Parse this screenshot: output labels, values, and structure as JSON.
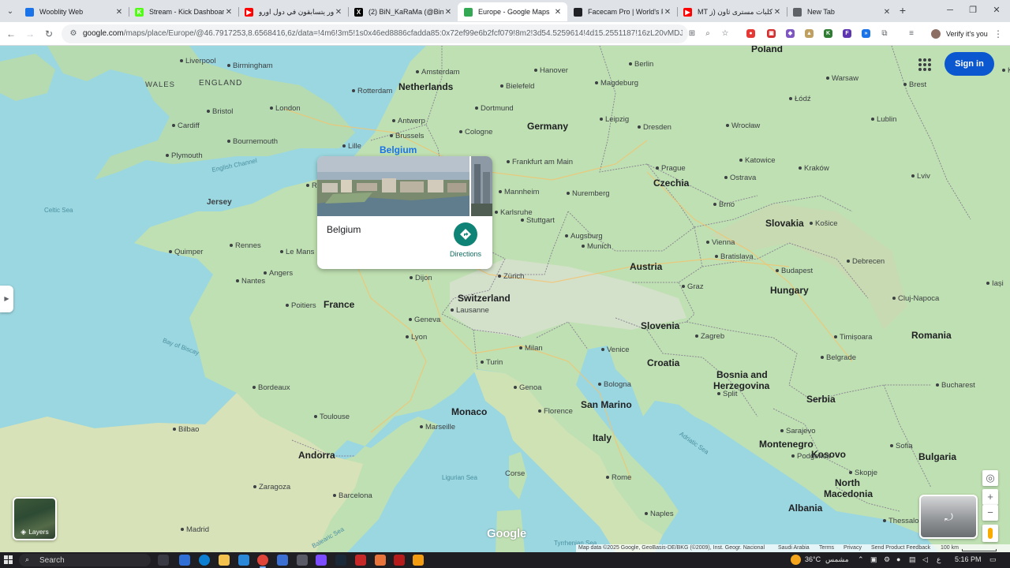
{
  "browser": {
    "tabs": [
      {
        "title": "Wooblity Web",
        "favicon_color": "#1a73e8",
        "favicon_glyph": "",
        "active": false
      },
      {
        "title": "Stream - Kick Dashboard",
        "favicon_color": "#53fc18",
        "favicon_glyph": "K",
        "active": false
      },
      {
        "title": "باور يتسابقون في دول اورو",
        "favicon_color": "#ff0000",
        "favicon_glyph": "▶",
        "active": false
      },
      {
        "title": "(2) BiN_KaRaMa (@Binn_li",
        "favicon_color": "#000000",
        "favicon_glyph": "X",
        "active": false
      },
      {
        "title": "Europe - Google Maps",
        "favicon_color": "#34a853",
        "favicon_glyph": "",
        "active": true
      },
      {
        "title": "Facecam Pro | World's Firs",
        "favicon_color": "#202124",
        "favicon_glyph": "",
        "active": false
      },
      {
        "title": "MT كلبات مسترى ثاون (ز",
        "favicon_color": "#ff0000",
        "favicon_glyph": "▶",
        "active": false
      },
      {
        "title": "New Tab",
        "favicon_color": "#5f6368",
        "favicon_glyph": "",
        "active": false
      }
    ],
    "url_host": "google.com",
    "url_path": "/maps/place/Europe/@46.7917253,8.6568416,6z/data=!4m6!3m5!1s0x46ed8886cfadda85:0x72ef99e6b2fcf079!8m2!3d54.5259614!4d15.2551187!16zL20vMDJqOXo?entry...",
    "profile_label": "Verify it's you",
    "extensions": [
      {
        "color": "#e53935",
        "glyph": "●"
      },
      {
        "color": "#d32f2f",
        "glyph": "▣"
      },
      {
        "color": "#7e57c2",
        "glyph": "◆"
      },
      {
        "color": "#c0a060",
        "glyph": "▲"
      },
      {
        "color": "#2e7d32",
        "glyph": "K"
      },
      {
        "color": "#5e35b1",
        "glyph": "F"
      },
      {
        "color": "#1a73e8",
        "glyph": "»"
      }
    ]
  },
  "map": {
    "signin_label": "Sign in",
    "place_card": {
      "hover_label": "Belgium",
      "title": "Belgium",
      "directions_label": "Directions"
    },
    "layers_label": "Layers",
    "logo": "Google",
    "attribution": {
      "data": "Map data ©2025 Google, GeoBasis-DE/BKG (©2009), Inst. Geogr. Nacional",
      "region": "Saudi Arabia",
      "terms": "Terms",
      "privacy": "Privacy",
      "feedback": "Send Product Feedback",
      "scale": "100 km"
    },
    "countries": [
      "Netherlands",
      "Germany",
      "Poland",
      "Czechia",
      "Slovakia",
      "Austria",
      "Hungary",
      "Switzerland",
      "France",
      "Slovenia",
      "Croatia",
      "Bosnia and",
      "Herzegovina",
      "Serbia",
      "Romania",
      "Monaco",
      "San Marino",
      "Italy",
      "Andorra",
      "Montenegro",
      "Kosovo",
      "Bulgaria",
      "North",
      "Macedonia",
      "Albania"
    ],
    "cities": [
      "Birmingham",
      "London",
      "Bristol",
      "Bournemouth",
      "Plymouth",
      "Rotterdam",
      "Amsterdam",
      "Antwerp",
      "Brussels",
      "Lille",
      "Dortmund",
      "Cologne",
      "Bielefeld",
      "Hanover",
      "Magdeburg",
      "Berlin",
      "Leipzig",
      "Dresden",
      "Frankfurt am Main",
      "Mannheim",
      "Nuremberg",
      "Karlsruhe",
      "Stuttgart",
      "Augsburg",
      "Munich",
      "Prague",
      "Wrocław",
      "Łódź",
      "Warsaw",
      "Lublin",
      "Katowice",
      "Kraków",
      "Ostrava",
      "Brno",
      "Vienna",
      "Bratislava",
      "Budapest",
      "Košice",
      "Lviv",
      "Zürich",
      "Geneva",
      "Lausanne",
      "Lyon",
      "Milan",
      "Turin",
      "Genoa",
      "Venice",
      "Bologna",
      "Florence",
      "Rome",
      "Naples",
      "Zagreb",
      "Belgrade",
      "Sarajevo",
      "Bucharest",
      "Sofia",
      "Cluj-Napoca",
      "Timișoara",
      "Rennes",
      "Nantes",
      "Le Mans",
      "Angers",
      "Poitiers",
      "Bordeaux",
      "Toulouse",
      "Marseille",
      "Bilbao",
      "Zaragoza",
      "Barcelona",
      "Madrid",
      "Quimper",
      "Dijon",
      "Graz",
      "Iași",
      "Skopje",
      "Thessaloniki",
      "Podgorica",
      "Split",
      "Debrecen",
      "Kyiv",
      "Brest",
      "Rouen",
      "Liverpool",
      "Cardiff"
    ],
    "country_labels": [
      "WALES",
      "ENGLAND"
    ],
    "water_labels": [
      "English Channel",
      "Celtic Sea",
      "Bay of Biscay",
      "Adriatic Sea",
      "Tyrrhenian Sea",
      "Balearic Sea",
      "Ligurian Sea"
    ],
    "islands": [
      "Jersey",
      "Corse"
    ]
  },
  "taskbar": {
    "search_label": "Search",
    "weather_temp": "36°C",
    "weather_desc": "مشمس",
    "language": "ع",
    "time": "5:16 PM"
  }
}
